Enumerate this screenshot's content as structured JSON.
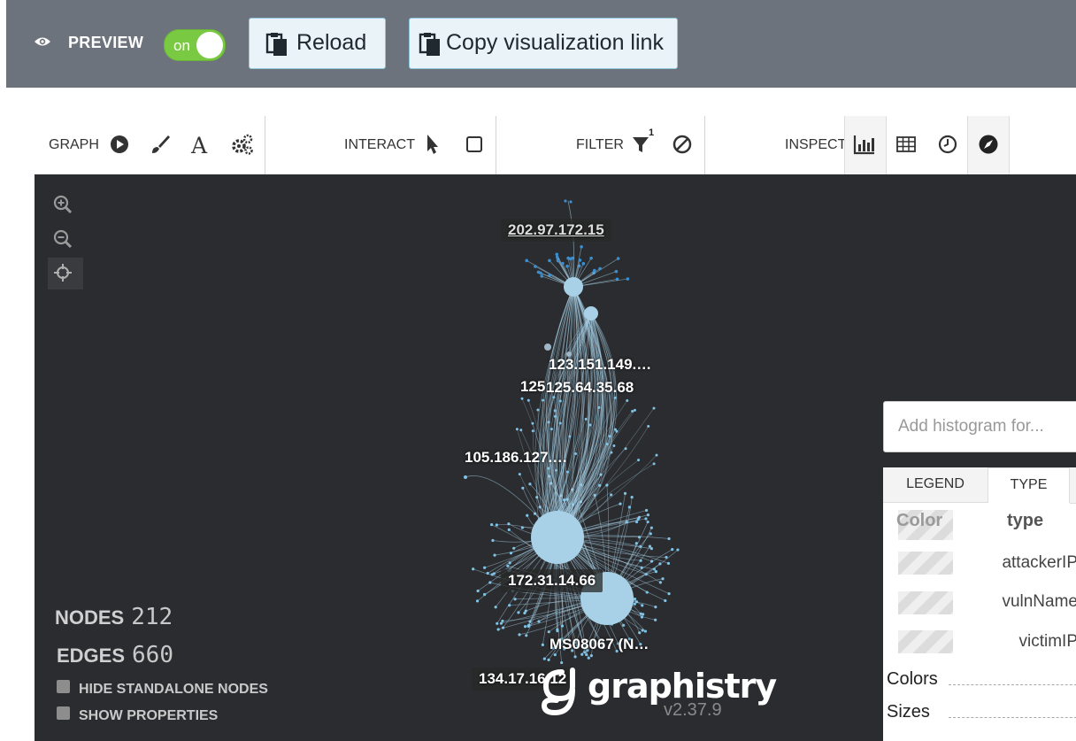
{
  "topbar": {
    "preview_label": "PREVIEW",
    "toggle_label": "on",
    "reload_label": "Reload",
    "copy_link_label": "Copy visualization link",
    "bg_color": "#6c737d",
    "toggle_color": "#7ac943"
  },
  "toolbar": {
    "graph_label": "GRAPH",
    "interact_label": "INTERACT",
    "filter_label": "FILTER",
    "filter_badge": "1",
    "inspect_label": "INSPECT",
    "icons": [
      "play-icon",
      "brush-icon",
      "font-icon",
      "gears-icon",
      "pointer-icon",
      "select-box-icon",
      "filter-icon",
      "no-icon",
      "histogram-icon",
      "table-icon",
      "clock-icon",
      "compass-icon"
    ]
  },
  "graph": {
    "node_labels": [
      "202.97.172.15",
      "123.151.149.…",
      "125.64.35.68",
      "125",
      "105.186.127.…",
      "172.31.14.66",
      "MS08067 (N…",
      "134.17.16.12"
    ],
    "stats": {
      "nodes_label": "NODES",
      "nodes_value": "212",
      "edges_label": "EDGES",
      "edges_value": "660"
    },
    "checkboxes": [
      "HIDE STANDALONE NODES",
      "SHOW PROPERTIES"
    ],
    "brand": "graphistry",
    "version": "v2.37.9",
    "edge_color": "#a6d0e6"
  },
  "histogram": {
    "placeholder": "Add histogram for..."
  },
  "legend": {
    "tabs": [
      "LEGEND",
      "TYPE"
    ],
    "col_color": "Color",
    "col_type": "type",
    "types": [
      "attackerIP",
      "vulnName",
      "victimIP"
    ],
    "colors_label": "Colors",
    "sizes_label": "Sizes"
  }
}
